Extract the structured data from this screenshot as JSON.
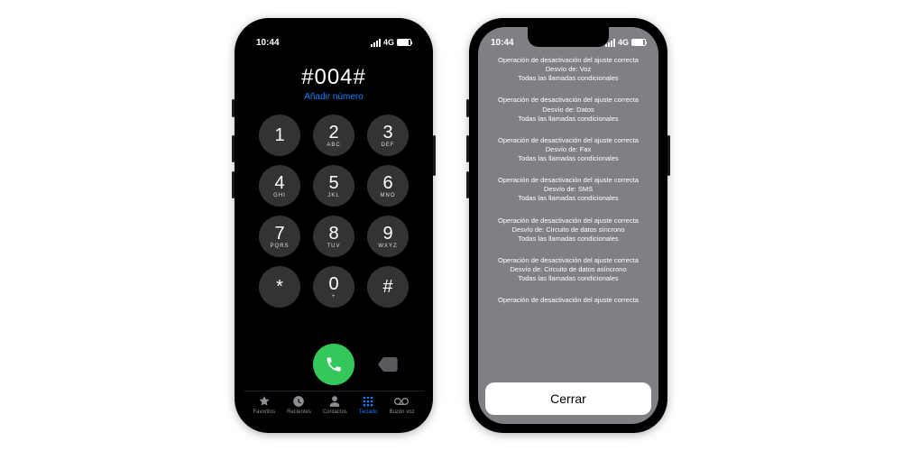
{
  "status": {
    "time": "10:44",
    "network": "4G"
  },
  "dialer": {
    "entered": "#004#",
    "add_number_label": "Añadir número",
    "keys": [
      {
        "digit": "1",
        "letters": ""
      },
      {
        "digit": "2",
        "letters": "ABC"
      },
      {
        "digit": "3",
        "letters": "DEF"
      },
      {
        "digit": "4",
        "letters": "GHI"
      },
      {
        "digit": "5",
        "letters": "JKL"
      },
      {
        "digit": "6",
        "letters": "MNO"
      },
      {
        "digit": "7",
        "letters": "PQRS"
      },
      {
        "digit": "8",
        "letters": "TUV"
      },
      {
        "digit": "9",
        "letters": "WXYZ"
      },
      {
        "digit": "*",
        "letters": ""
      },
      {
        "digit": "0",
        "letters": "+"
      },
      {
        "digit": "#",
        "letters": ""
      }
    ],
    "tabs": [
      {
        "id": "favorites",
        "label": "Favoritos"
      },
      {
        "id": "recents",
        "label": "Recientes"
      },
      {
        "id": "contacts",
        "label": "Contactos"
      },
      {
        "id": "keypad",
        "label": "Teclado"
      },
      {
        "id": "voicemail",
        "label": "Buzón voz"
      }
    ],
    "active_tab": "keypad"
  },
  "result": {
    "messages": [
      {
        "line1": "Operación de desactivación del ajuste correcta",
        "line2": "Desvío de: Voz",
        "line3": "Todas las llamadas condicionales"
      },
      {
        "line1": "Operación de desactivación del ajuste correcta",
        "line2": "Desvío de: Datos",
        "line3": "Todas las llamadas condicionales"
      },
      {
        "line1": "Operación de desactivación del ajuste correcta",
        "line2": "Desvío de: Fax",
        "line3": "Todas las llamadas condicionales"
      },
      {
        "line1": "Operación de desactivación del ajuste correcta",
        "line2": "Desvío de: SMS",
        "line3": "Todas las llamadas condicionales"
      },
      {
        "line1": "Operación de desactivación del ajuste correcta",
        "line2": "Desvío de: Circuito de datos síncrono",
        "line3": "Todas las llamadas condicionales"
      },
      {
        "line1": "Operación de desactivación del ajuste correcta",
        "line2": "Desvío de: Circuito de datos asíncrono",
        "line3": "Todas las llamadas condicionales"
      }
    ],
    "cut_line": "Operación de desactivación del ajuste correcta",
    "close_label": "Cerrar"
  }
}
